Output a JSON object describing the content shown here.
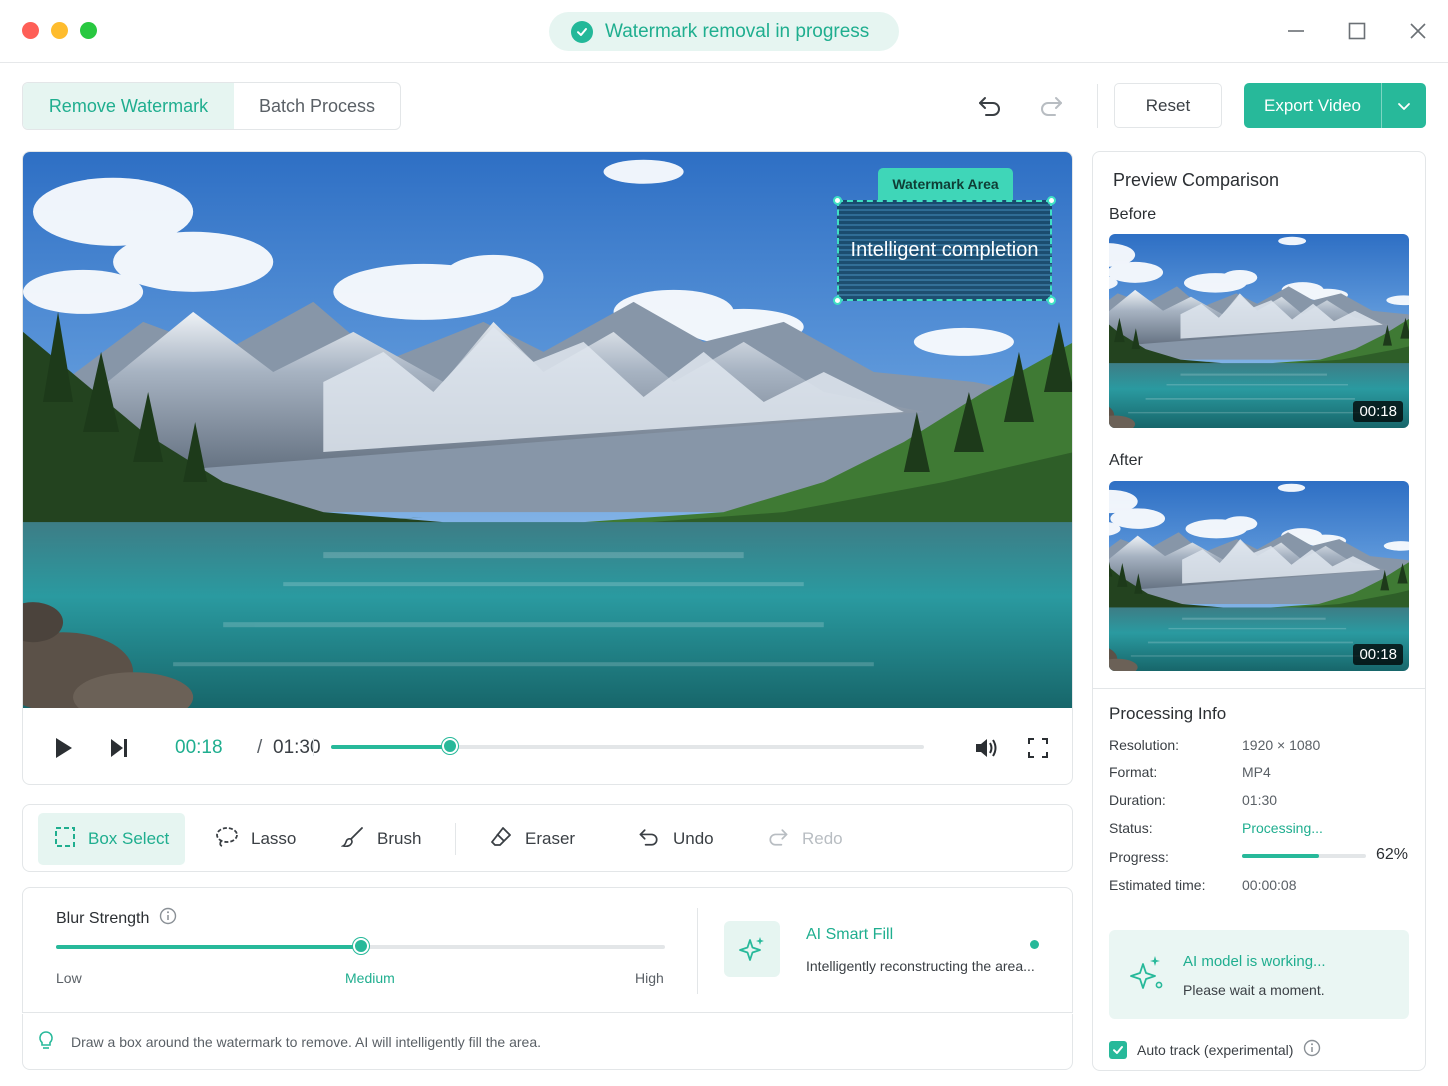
{
  "titlebar": {
    "status_text": "Watermark removal in progress"
  },
  "toolbar": {
    "tabs": [
      {
        "label": "Remove Watermark",
        "active": true
      },
      {
        "label": "Batch Process",
        "active": false
      }
    ],
    "reset_label": "Reset",
    "export_label": "Export Video"
  },
  "video": {
    "watermark_tag": "Watermark Area",
    "watermark_box_text": "Intelligent completion",
    "time_current": "00:18",
    "time_separator": "/",
    "time_total": "01:30",
    "progress_fraction": 0.2
  },
  "tools": {
    "items": [
      {
        "label": "Box Select",
        "icon": "box-select-icon",
        "active": true
      },
      {
        "label": "Lasso",
        "icon": "lasso-icon"
      },
      {
        "label": "Brush",
        "icon": "brush-icon"
      },
      {
        "label": "Eraser",
        "icon": "eraser-icon"
      },
      {
        "label": "Undo",
        "icon": "undo-icon"
      },
      {
        "label": "Redo",
        "icon": "redo-icon",
        "disabled": true
      }
    ]
  },
  "blur": {
    "title": "Blur Strength",
    "level_fraction": 0.5,
    "low": "Low",
    "medium": "Medium",
    "high": "High"
  },
  "ai_fill": {
    "title": "AI Smart Fill",
    "description": "Intelligently reconstructing the area..."
  },
  "hint": "Draw a box around the watermark to remove. AI will intelligently fill the area.",
  "preview": {
    "title": "Preview Comparison",
    "before_label": "Before",
    "after_label": "After",
    "before_time": "00:18",
    "after_time": "00:18"
  },
  "processing": {
    "title": "Processing Info",
    "rows": [
      {
        "key": "Resolution:",
        "value": "1920 × 1080"
      },
      {
        "key": "Format:",
        "value": "MP4"
      },
      {
        "key": "Duration:",
        "value": "01:30"
      },
      {
        "key": "Status:",
        "value": "Processing..."
      },
      {
        "key": "Progress:",
        "value": ""
      },
      {
        "key": "Estimated time:",
        "value": "00:00:08"
      }
    ],
    "progress_percent": 62,
    "progress_label": "62%"
  },
  "ai_working": {
    "title": "AI model is working...",
    "description": "Please wait a moment."
  },
  "auto_track": {
    "label": "Auto track (experimental)",
    "checked": true
  },
  "colors": {
    "accent": "#27b99a",
    "accent_text": "#1fae8f",
    "accent_bg": "#e6f5f1"
  }
}
